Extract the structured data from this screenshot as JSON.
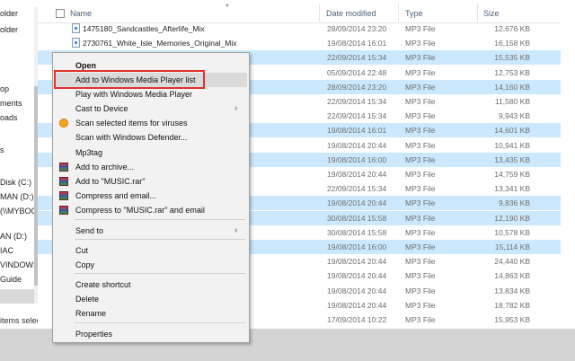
{
  "nav": {
    "items": [
      "older",
      "older",
      "",
      "",
      "op",
      "ments",
      "oads",
      "",
      "s",
      "",
      "Disk (C:)",
      "MAN (D:)",
      "(\\\\MYBOO",
      "",
      "AN (D:)",
      "IAC",
      "VINDOWS",
      "Guide"
    ]
  },
  "status": {
    "text": "items selected"
  },
  "header": {
    "name": "Name",
    "date": "Date modified",
    "type": "Type",
    "size": "Size"
  },
  "rows": [
    {
      "name": "1475180_Sandcastles_Afterlife_Mix",
      "date": "28/09/2014 23:20",
      "type": "MP3 File",
      "size": "12,676 KB",
      "selected": false
    },
    {
      "name": "2730761_White_Isle_Memories_Original_Mix",
      "date": "19/08/2014 16:01",
      "type": "MP3 File",
      "size": "16,158 KB",
      "selected": false
    },
    {
      "name": "inal_Mix",
      "date": "22/09/2014 15:34",
      "type": "MP3 File",
      "size": "15,535 KB",
      "selected": true
    },
    {
      "name": "",
      "date": "05/09/2014 22:48",
      "type": "MP3 File",
      "size": "12,753 KB",
      "selected": false
    },
    {
      "name": "",
      "date": "28/09/2014 23:20",
      "type": "MP3 File",
      "size": "14,160 KB",
      "selected": true
    },
    {
      "name": "riginal_Mix",
      "date": "22/09/2014 15:34",
      "type": "MP3 File",
      "size": "11,580 KB",
      "selected": false
    },
    {
      "name": "",
      "date": "22/09/2014 15:34",
      "type": "MP3 File",
      "size": "9,943 KB",
      "selected": false
    },
    {
      "name": "",
      "date": "19/08/2014 16:01",
      "type": "MP3 File",
      "size": "14,601 KB",
      "selected": true
    },
    {
      "name": "",
      "date": "19/08/2014 20:44",
      "type": "MP3 File",
      "size": "10,941 KB",
      "selected": false
    },
    {
      "name": "Ik__Sugar_2014_E...",
      "date": "19/08/2014 16:00",
      "type": "MP3 File",
      "size": "13,435 KB",
      "selected": true
    },
    {
      "name": "",
      "date": "19/08/2014 20:44",
      "type": "MP3 File",
      "size": "14,759 KB",
      "selected": false
    },
    {
      "name": "inal_Mix",
      "date": "22/09/2014 15:34",
      "type": "MP3 File",
      "size": "13,341 KB",
      "selected": false
    },
    {
      "name": "",
      "date": "19/08/2014 20:44",
      "type": "MP3 File",
      "size": "9,836 KB",
      "selected": true
    },
    {
      "name": "",
      "date": "30/08/2014 15:58",
      "type": "MP3 File",
      "size": "12,190 KB",
      "selected": true
    },
    {
      "name": "",
      "date": "30/08/2014 15:58",
      "type": "MP3 File",
      "size": "10,578 KB",
      "selected": false
    },
    {
      "name": "eshifters_Stripped_...",
      "date": "19/08/2014 16:00",
      "type": "MP3 File",
      "size": "15,114 KB",
      "selected": true
    },
    {
      "name": "a_10_Remix",
      "date": "19/08/2014 20:44",
      "type": "MP3 File",
      "size": "24,440 KB",
      "selected": false
    },
    {
      "name": "ix",
      "date": "19/08/2014 20:44",
      "type": "MP3 File",
      "size": "14,863 KB",
      "selected": false
    },
    {
      "name": "_Puma_Remix",
      "date": "19/08/2014 20:44",
      "type": "MP3 File",
      "size": "13,834 KB",
      "selected": false
    },
    {
      "name": "Remix",
      "date": "19/08/2014 20:44",
      "type": "MP3 File",
      "size": "18,782 KB",
      "selected": false
    },
    {
      "name": "",
      "date": "17/09/2014 10:22",
      "type": "MP3 File",
      "size": "15,953 KB",
      "selected": false
    }
  ],
  "context_menu": {
    "items": [
      {
        "label": "Open",
        "bold": true
      },
      {
        "label": "Add to Windows Media Player list",
        "hover": true
      },
      {
        "label": "Play with Windows Media Player"
      },
      {
        "label": "Cast to Device",
        "submenu": true
      },
      {
        "label": "Scan selected items for viruses",
        "icon": "antivirus-icon"
      },
      {
        "label": "Scan with Windows Defender..."
      },
      {
        "label": "Mp3tag"
      },
      {
        "label": "Add to archive...",
        "icon": "winrar-icon"
      },
      {
        "label": "Add to \"MUSIC.rar\"",
        "icon": "winrar-icon"
      },
      {
        "label": "Compress and email...",
        "icon": "winrar-icon"
      },
      {
        "label": "Compress to \"MUSIC.rar\" and email",
        "icon": "winrar-icon"
      },
      {
        "label": "Send to",
        "submenu": true
      },
      {
        "label": "Cut"
      },
      {
        "label": "Copy"
      },
      {
        "label": "Create shortcut"
      },
      {
        "label": "Delete"
      },
      {
        "label": "Rename"
      },
      {
        "label": "Properties"
      }
    ]
  },
  "colors": {
    "selection": "#cce8ff",
    "highlight_box": "#e0312d",
    "menu_bg": "#f2f2f2"
  }
}
